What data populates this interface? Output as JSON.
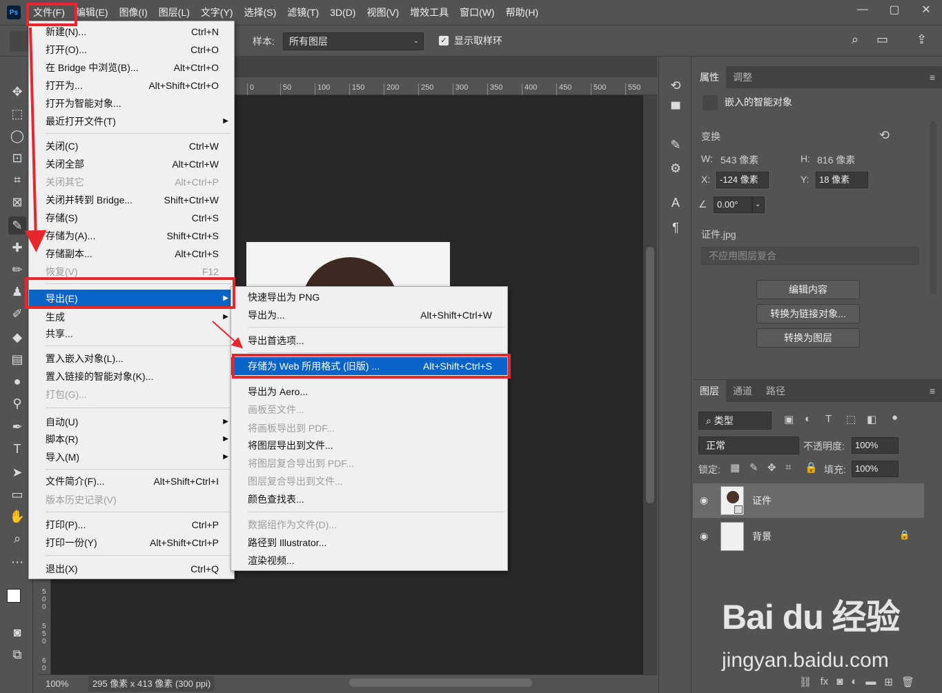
{
  "menubar": {
    "items": [
      "文件(F)",
      "编辑(E)",
      "图像(I)",
      "图层(L)",
      "文字(Y)",
      "选择(S)",
      "滤镜(T)",
      "3D(D)",
      "视图(V)",
      "增效工具",
      "窗口(W)",
      "帮助(H)"
    ],
    "logo": "Ps"
  },
  "options": {
    "sample_label": "样本:",
    "sample_value": "所有图层",
    "show_ring_label": "显示取样环"
  },
  "ruler": {
    "ticks": [
      "0",
      "50",
      "100",
      "150",
      "200",
      "250",
      "300",
      "350",
      "400",
      "450",
      "500",
      "550"
    ],
    "left_ticks": [
      "5 0 0",
      "5 5 0",
      "6 0"
    ]
  },
  "status": {
    "zoom": "100%",
    "doc_info": "295 像素 x 413 像素 (300 ppi)"
  },
  "file_menu": {
    "items": [
      {
        "label": "新建(N)...",
        "shortcut": "Ctrl+N"
      },
      {
        "label": "打开(O)...",
        "shortcut": "Ctrl+O"
      },
      {
        "label": "在 Bridge 中浏览(B)...",
        "shortcut": "Alt+Ctrl+O"
      },
      {
        "label": "打开为...",
        "shortcut": "Alt+Shift+Ctrl+O"
      },
      {
        "label": "打开为智能对象...",
        "shortcut": ""
      },
      {
        "label": "最近打开文件(T)",
        "shortcut": ""
      },
      {
        "label": "关闭(C)",
        "shortcut": "Ctrl+W"
      },
      {
        "label": "关闭全部",
        "shortcut": "Alt+Ctrl+W"
      },
      {
        "label": "关闭其它",
        "shortcut": "Alt+Ctrl+P"
      },
      {
        "label": "关闭并转到 Bridge...",
        "shortcut": "Shift+Ctrl+W"
      },
      {
        "label": "存储(S)",
        "shortcut": "Ctrl+S"
      },
      {
        "label": "存储为(A)...",
        "shortcut": "Shift+Ctrl+S"
      },
      {
        "label": "存储副本...",
        "shortcut": "Alt+Ctrl+S"
      },
      {
        "label": "恢复(V)",
        "shortcut": "F12"
      },
      {
        "label": "导出(E)",
        "shortcut": ""
      },
      {
        "label": "生成",
        "shortcut": ""
      },
      {
        "label": "共享...",
        "shortcut": ""
      },
      {
        "label": "置入嵌入对象(L)...",
        "shortcut": ""
      },
      {
        "label": "置入链接的智能对象(K)...",
        "shortcut": ""
      },
      {
        "label": "打包(G)...",
        "shortcut": ""
      },
      {
        "label": "自动(U)",
        "shortcut": ""
      },
      {
        "label": "脚本(R)",
        "shortcut": ""
      },
      {
        "label": "导入(M)",
        "shortcut": ""
      },
      {
        "label": "文件简介(F)...",
        "shortcut": "Alt+Shift+Ctrl+I"
      },
      {
        "label": "版本历史记录(V)",
        "shortcut": ""
      },
      {
        "label": "打印(P)...",
        "shortcut": "Ctrl+P"
      },
      {
        "label": "打印一份(Y)",
        "shortcut": "Alt+Shift+Ctrl+P"
      },
      {
        "label": "退出(X)",
        "shortcut": "Ctrl+Q"
      }
    ]
  },
  "export_menu": {
    "items": [
      {
        "label": "快速导出为 PNG",
        "shortcut": ""
      },
      {
        "label": "导出为...",
        "shortcut": "Alt+Shift+Ctrl+W"
      },
      {
        "label": "导出首选项...",
        "shortcut": ""
      },
      {
        "label": "存储为 Web 所用格式 (旧版) ...",
        "shortcut": "Alt+Shift+Ctrl+S"
      },
      {
        "label": "导出为 Aero...",
        "shortcut": ""
      },
      {
        "label": "画板至文件...",
        "shortcut": ""
      },
      {
        "label": "将画板导出到 PDF...",
        "shortcut": ""
      },
      {
        "label": "将图层导出到文件...",
        "shortcut": ""
      },
      {
        "label": "将图层复合导出到 PDF...",
        "shortcut": ""
      },
      {
        "label": "图层复合导出到文件...",
        "shortcut": ""
      },
      {
        "label": "颜色查找表...",
        "shortcut": ""
      },
      {
        "label": "数据组作为文件(D)...",
        "shortcut": ""
      },
      {
        "label": "路径到 Illustrator...",
        "shortcut": ""
      },
      {
        "label": "渲染视频...",
        "shortcut": ""
      }
    ]
  },
  "properties": {
    "tabs": [
      "属性",
      "调整"
    ],
    "type": "嵌入的智能对象",
    "transform_label": "变换",
    "w_label": "W:",
    "w_value": "543 像素",
    "h_label": "H:",
    "h_value": "816 像素",
    "x_label": "X:",
    "x_value": "-124 像素",
    "y_label": "Y:",
    "y_value": "18 像素",
    "angle": "0.00°",
    "filename": "证件.jpg",
    "comp_placeholder": "不应用图层复合",
    "btn_edit": "编辑内容",
    "btn_link": "转换为链接对象...",
    "btn_layer": "转换为图层"
  },
  "layers": {
    "tabs": [
      "图层",
      "通道",
      "路径"
    ],
    "filter": "类型",
    "blend": "正常",
    "opacity_label": "不透明度:",
    "opacity": "100%",
    "lock_label": "锁定:",
    "fill_label": "填充:",
    "fill": "100%",
    "rows": [
      {
        "name": "证件"
      },
      {
        "name": "背景"
      }
    ]
  },
  "watermark": {
    "logo": "Bai du 经验",
    "url": "jingyan.baidu.com"
  }
}
